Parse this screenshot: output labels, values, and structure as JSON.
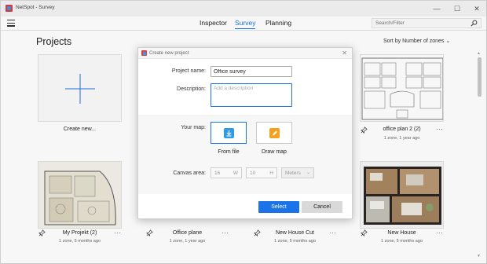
{
  "window": {
    "title": "NetSpot - Survey",
    "minimize": "—",
    "maximize": "☐",
    "close": "✕"
  },
  "toolbar": {
    "tabs": [
      {
        "label": "Inspector",
        "active": false
      },
      {
        "label": "Survey",
        "active": true
      },
      {
        "label": "Planning",
        "active": false
      }
    ],
    "search_placeholder": "Search/Filter"
  },
  "main": {
    "title": "Projects",
    "sort_label": "Sort by Number of zones",
    "sort_chevron": "⌄",
    "projects": [
      {
        "name": "Create new...",
        "details": ""
      },
      {
        "name": "office plan 2 (2)",
        "details": "1 zone, 1 year ago"
      },
      {
        "name": "My Projekt (2)",
        "details": "1 zone, 5 months ago"
      },
      {
        "name": "Office plane",
        "details": "1 zone, 1 year ago"
      },
      {
        "name": "New House Cut",
        "details": "1 zone, 5 months ago"
      },
      {
        "name": "New House",
        "details": "1 zone, 5 months ago"
      }
    ],
    "more_glyph": "···"
  },
  "dialog": {
    "title": "Create new project",
    "close": "✕",
    "project_name_label": "Project name:",
    "project_name_value": "Office survey",
    "description_label": "Description:",
    "description_placeholder": "Add a description",
    "map_label": "Your map:",
    "map_options": [
      {
        "label": "From file",
        "selected": true
      },
      {
        "label": "Draw map",
        "selected": false
      }
    ],
    "canvas_label": "Canvas area:",
    "canvas_width": "16",
    "canvas_width_unit": "W",
    "canvas_height": "10",
    "canvas_height_unit": "H",
    "canvas_units": "Meters",
    "select_button": "Select",
    "cancel_button": "Cancel"
  },
  "colors": {
    "accent": "#1a73e8",
    "upload_icon": "#2f9be8",
    "draw_icon": "#f7a01d"
  }
}
